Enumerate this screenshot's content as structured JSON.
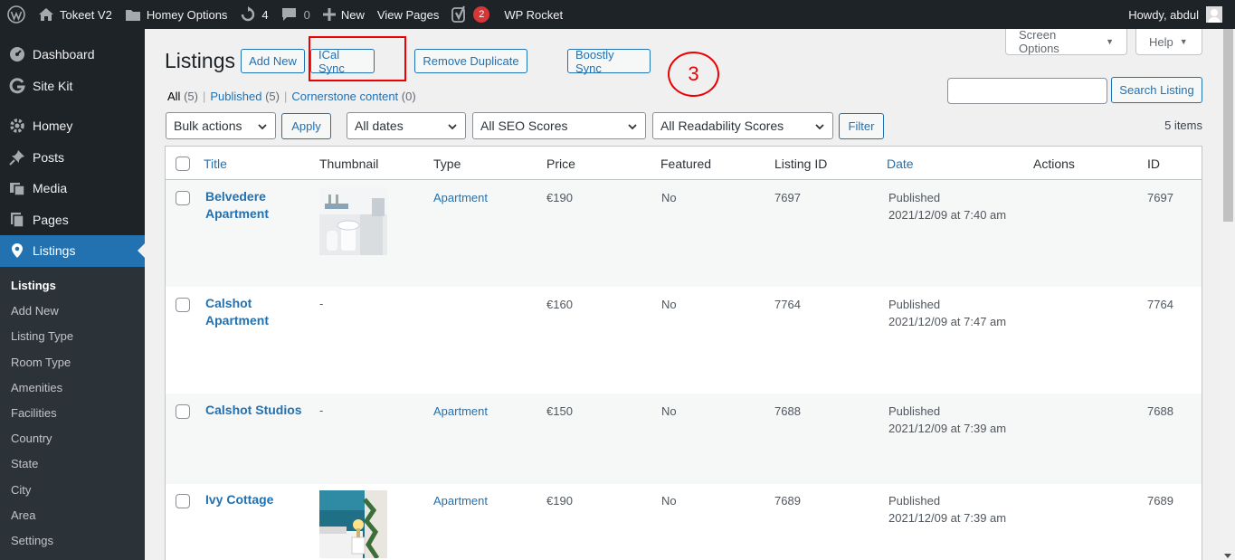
{
  "adminbar": {
    "site_name": "Tokeet V2",
    "homey_options": "Homey Options",
    "updates_count": "4",
    "comments_count": "0",
    "new_label": "New",
    "view_pages": "View Pages",
    "yoast_badge": "2",
    "wp_rocket": "WP Rocket",
    "howdy": "Howdy, abdul"
  },
  "sidebar": {
    "items": [
      {
        "label": "Dashboard",
        "icon": "dashboard-icon"
      },
      {
        "label": "Site Kit",
        "icon": "site-kit-icon"
      },
      {
        "label": "Homey",
        "icon": "homey-icon"
      },
      {
        "label": "Posts",
        "icon": "pin-icon"
      },
      {
        "label": "Media",
        "icon": "media-icon"
      },
      {
        "label": "Pages",
        "icon": "pages-icon"
      },
      {
        "label": "Listings",
        "icon": "location-icon"
      }
    ],
    "submenu": [
      "Listings",
      "Add New",
      "Listing Type",
      "Room Type",
      "Amenities",
      "Facilities",
      "Country",
      "State",
      "City",
      "Area",
      "Settings"
    ]
  },
  "header": {
    "title": "Listings",
    "add_new": "Add New",
    "ical_sync": "ICal Sync",
    "remove_duplicate": "Remove Duplicate",
    "boostly_sync": "Boostly Sync",
    "annotation_number": "3",
    "screen_options": "Screen Options",
    "help": "Help"
  },
  "filters_links": {
    "all": "All",
    "all_count": "(5)",
    "published": "Published",
    "published_count": "(5)",
    "cornerstone": "Cornerstone content",
    "cornerstone_count": "(0)",
    "sep": "|"
  },
  "search": {
    "button": "Search Listing",
    "value": ""
  },
  "toolbar": {
    "bulk_actions": "Bulk actions",
    "apply": "Apply",
    "all_dates": "All dates",
    "seo_scores": "All SEO Scores",
    "readability": "All Readability Scores",
    "filter": "Filter",
    "items_count": "5 items"
  },
  "table": {
    "columns": [
      "Title",
      "Thumbnail",
      "Type",
      "Price",
      "Featured",
      "Listing ID",
      "Date",
      "Actions",
      "ID"
    ],
    "rows": [
      {
        "title": "Belvedere Apartment",
        "thumbnail": "",
        "type": "Apartment",
        "price": "€190",
        "featured": "No",
        "listing_id": "7697",
        "date_status": "Published",
        "date": "2021/12/09 at 7:40 am",
        "id": "7697"
      },
      {
        "title": "Calshot Apartment",
        "thumbnail": "-",
        "type": "",
        "price": "€160",
        "featured": "No",
        "listing_id": "7764",
        "date_status": "Published",
        "date": "2021/12/09 at 7:47 am",
        "id": "7764"
      },
      {
        "title": "Calshot Studios",
        "thumbnail": "-",
        "type": "Apartment",
        "price": "€150",
        "featured": "No",
        "listing_id": "7688",
        "date_status": "Published",
        "date": "2021/12/09 at 7:39 am",
        "id": "7688"
      },
      {
        "title": "Ivy Cottage",
        "thumbnail": "",
        "type": "Apartment",
        "price": "€190",
        "featured": "No",
        "listing_id": "7689",
        "date_status": "Published",
        "date": "2021/12/09 at 7:39 am",
        "id": "7689"
      }
    ]
  },
  "colors": {
    "adminbar_bg": "#1d2327",
    "accent": "#2271b1",
    "annotation": "#e00000"
  }
}
